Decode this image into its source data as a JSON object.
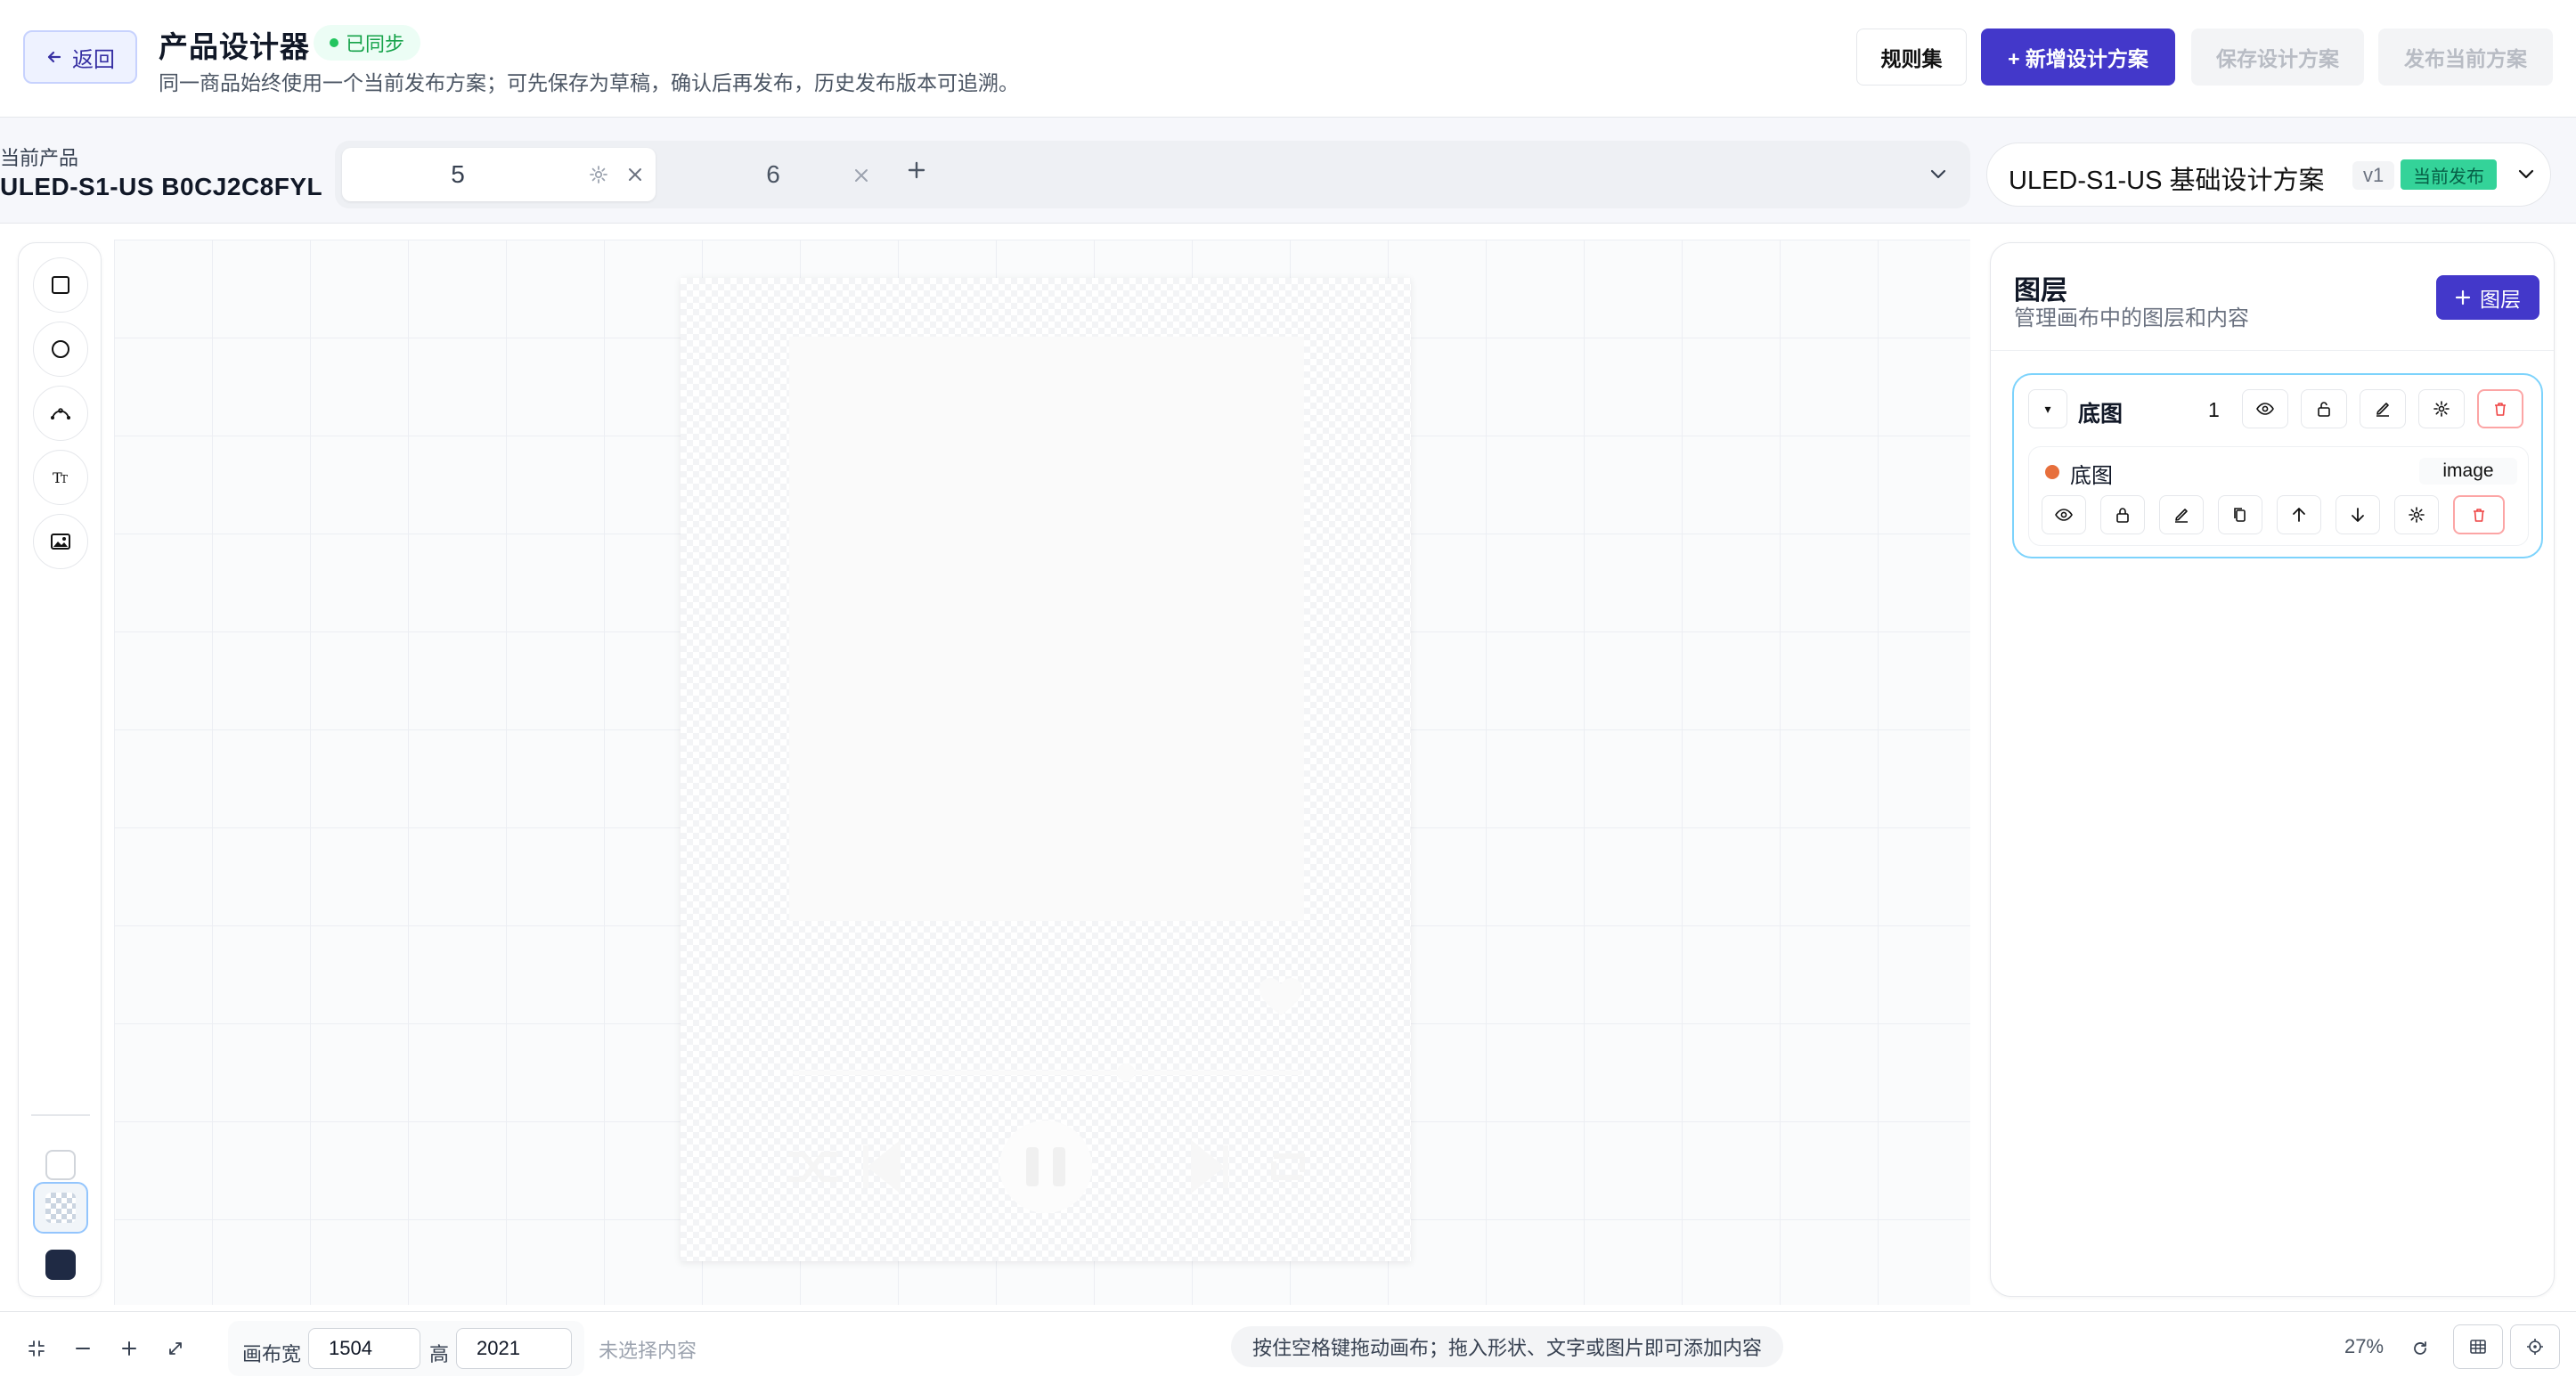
{
  "header": {
    "back_label": "返回",
    "title": "产品设计器",
    "sync_status": "已同步",
    "subtitle": "同一商品始终使用一个当前发布方案；可先保存为草稿，确认后再发布，历史发布版本可追溯。",
    "rules_label": "规则集",
    "new_scheme_label": "+ 新增设计方案",
    "save_scheme_label": "保存设计方案",
    "publish_label": "发布当前方案"
  },
  "product": {
    "label": "当前产品",
    "code": "ULED-S1-US B0CJ2C8FYL"
  },
  "tabs": [
    {
      "label": "5",
      "active": true
    },
    {
      "label": "6",
      "active": false
    }
  ],
  "scheme": {
    "name": "ULED-S1-US 基础设计方案",
    "version": "v1",
    "status": "当前发布"
  },
  "layers_panel": {
    "title": "图层",
    "subtitle": "管理画布中的图层和内容",
    "add_label": "图层",
    "group": {
      "name": "底图",
      "count": "1",
      "item": {
        "name": "底图",
        "type": "image",
        "color": "#e76f3c"
      }
    }
  },
  "bottombar": {
    "width_label": "画布宽",
    "width_value": "1504",
    "height_label": "高",
    "height_value": "2021",
    "selection_status": "未选择内容",
    "hint": "按住空格键拖动画布；拖入形状、文字或图片即可添加内容",
    "zoom": "27%"
  },
  "colors": {
    "accent": "#4338ca",
    "published_badge": "#34d399",
    "sync_green": "#16a34a",
    "layer_group_border": "#7dd3fc",
    "danger": "#ef4444"
  }
}
